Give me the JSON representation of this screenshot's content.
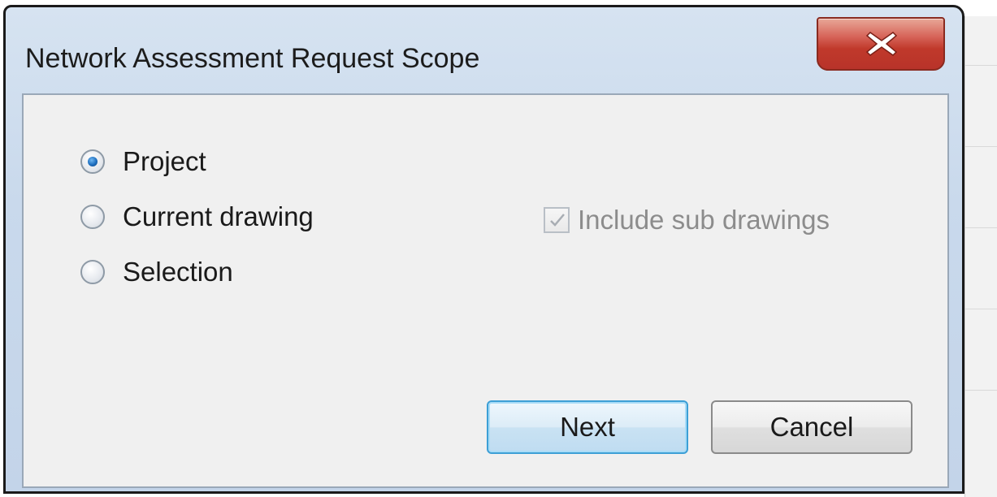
{
  "window": {
    "title": "Network Assessment Request Scope",
    "close_icon": "close-icon"
  },
  "scope": {
    "options": [
      {
        "label": "Project",
        "selected": true
      },
      {
        "label": "Current drawing",
        "selected": false
      },
      {
        "label": "Selection",
        "selected": false
      }
    ],
    "include_sub_drawings": {
      "label": "Include sub drawings",
      "checked": true,
      "enabled": false
    }
  },
  "buttons": {
    "next": "Next",
    "cancel": "Cancel"
  },
  "colors": {
    "close_button": "#c0392b",
    "default_button_border": "#3c9fd6",
    "radio_selected": "#1d6ebf",
    "disabled_text": "#8c8c8c"
  }
}
